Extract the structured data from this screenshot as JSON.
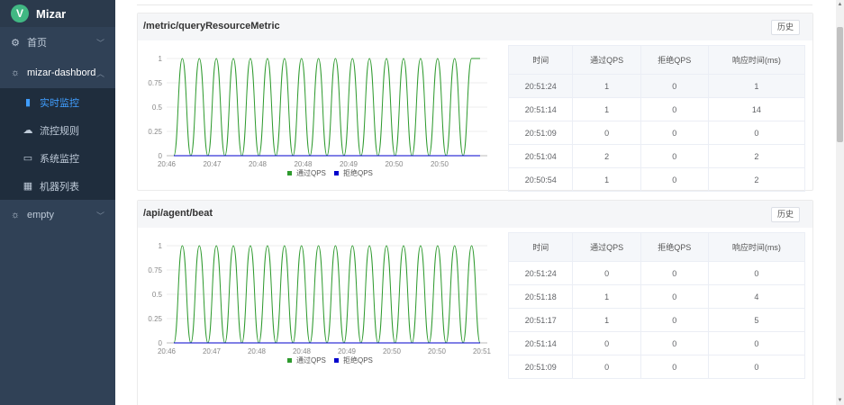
{
  "app": {
    "name": "Mizar",
    "logo_letter": "V"
  },
  "sidebar": {
    "items": [
      {
        "label": "首页",
        "icon": "gear-icon",
        "glyph": "⚙"
      },
      {
        "label": "mizar-dashbord",
        "icon": "sun-icon",
        "glyph": "☼"
      }
    ],
    "subitems": [
      {
        "label": "实时监控",
        "icon": "bar-chart-icon",
        "glyph": "▮"
      },
      {
        "label": "流控规则",
        "icon": "cloud-icon",
        "glyph": "☁"
      },
      {
        "label": "系统监控",
        "icon": "monitor-icon",
        "glyph": "▭"
      },
      {
        "label": "机器列表",
        "icon": "grid-icon",
        "glyph": "▦"
      }
    ],
    "extra": {
      "label": "empty",
      "icon": "sun-icon",
      "glyph": "☼"
    }
  },
  "history_label": "历史",
  "table_headers": [
    "时间",
    "通过QPS",
    "拒绝QPS",
    "响应时间(ms)"
  ],
  "legend": {
    "pass": "通过QPS",
    "reject": "拒绝QPS"
  },
  "colors": {
    "pass": "#2e9a2e",
    "reject": "#0000cc",
    "accent": "#409eff",
    "sidebar": "#304156"
  },
  "panels": [
    {
      "title": "/metric/queryResourceMetric",
      "rows": [
        [
          "20:51:24",
          "1",
          "0",
          "1"
        ],
        [
          "20:51:14",
          "1",
          "0",
          "14"
        ],
        [
          "20:51:09",
          "0",
          "0",
          "0"
        ],
        [
          "20:51:04",
          "2",
          "0",
          "2"
        ],
        [
          "20:50:54",
          "1",
          "0",
          "2"
        ]
      ]
    },
    {
      "title": "/api/agent/beat",
      "rows": [
        [
          "20:51:24",
          "0",
          "0",
          "0"
        ],
        [
          "20:51:18",
          "1",
          "0",
          "4"
        ],
        [
          "20:51:17",
          "1",
          "0",
          "5"
        ],
        [
          "20:51:14",
          "0",
          "0",
          "0"
        ],
        [
          "20:51:09",
          "0",
          "0",
          "0"
        ]
      ]
    }
  ],
  "chart_data": [
    {
      "type": "line",
      "y_ticks": [
        "0",
        "0.25",
        "0.5",
        "0.75",
        "1"
      ],
      "x_ticks": [
        "20:46",
        "20:47",
        "20:48",
        "20:48",
        "20:49",
        "20:50",
        "20:50"
      ],
      "ylim": [
        0,
        1
      ],
      "legend_position": "bottom",
      "series": [
        {
          "name": "通过QPS",
          "values": [
            0,
            1,
            0,
            1,
            0,
            1,
            0,
            1,
            0,
            1,
            0,
            1,
            0,
            1,
            0,
            1,
            0,
            1,
            0,
            1,
            0,
            1,
            0,
            1,
            0,
            1,
            0,
            1,
            0,
            1,
            0,
            1,
            0,
            1,
            0,
            1,
            1
          ]
        },
        {
          "name": "拒绝QPS",
          "values": [
            0,
            0,
            0,
            0,
            0,
            0,
            0,
            0,
            0,
            0,
            0,
            0,
            0,
            0,
            0,
            0,
            0,
            0,
            0,
            0,
            0,
            0,
            0,
            0,
            0,
            0,
            0,
            0,
            0,
            0,
            0,
            0,
            0,
            0,
            0,
            0,
            0
          ]
        }
      ]
    },
    {
      "type": "line",
      "y_ticks": [
        "0",
        "0.25",
        "0.5",
        "0.75",
        "1"
      ],
      "x_ticks": [
        "20:46",
        "20:47",
        "20:48",
        "20:48",
        "20:49",
        "20:50",
        "20:50",
        "20:51"
      ],
      "ylim": [
        0,
        1
      ],
      "legend_position": "bottom",
      "series": [
        {
          "name": "通过QPS",
          "values": [
            0,
            1,
            0,
            1,
            0,
            1,
            0,
            1,
            0,
            1,
            0,
            1,
            0,
            1,
            0,
            1,
            0,
            1,
            0,
            1,
            0,
            1,
            0,
            1,
            0,
            1,
            0,
            1,
            0,
            1,
            0,
            1,
            0,
            1,
            0,
            1,
            0
          ]
        },
        {
          "name": "拒绝QPS",
          "values": [
            0,
            0,
            0,
            0,
            0,
            0,
            0,
            0,
            0,
            0,
            0,
            0,
            0,
            0,
            0,
            0,
            0,
            0,
            0,
            0,
            0,
            0,
            0,
            0,
            0,
            0,
            0,
            0,
            0,
            0,
            0,
            0,
            0,
            0,
            0,
            0,
            0
          ]
        }
      ]
    }
  ]
}
